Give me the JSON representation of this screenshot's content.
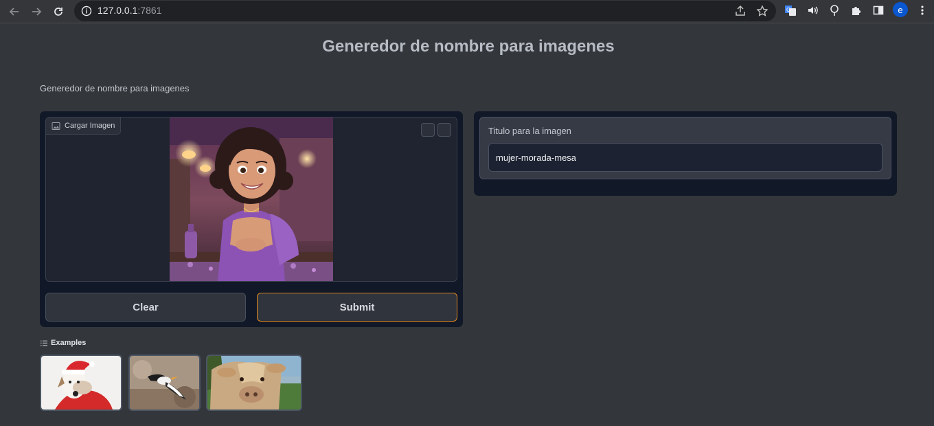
{
  "browser": {
    "url_host": "127.0.0.1",
    "url_port": ":7861",
    "profile_initial": "e",
    "icons": [
      "back-icon",
      "forward-icon",
      "reload-icon",
      "site-info-icon",
      "share-icon",
      "bookmark-star-icon",
      "translate-icon",
      "speaker-icon",
      "lens-icon",
      "extensions-icon",
      "side-panel-icon",
      "more-icon"
    ]
  },
  "app": {
    "title": "Generedor de nombre para imagenes",
    "description": "Generedor de nombre para imagenes"
  },
  "input_panel": {
    "image_label": "Cargar Imagen",
    "clear_label": "Clear",
    "submit_label": "Submit"
  },
  "output_panel": {
    "label": "Titulo para la imagen",
    "value": "mujer-morada-mesa"
  },
  "examples": {
    "title": "Examples",
    "items": [
      "dog-with-santa-hat",
      "bird-flying",
      "cow-close-up"
    ]
  },
  "colors": {
    "background": "#33363b",
    "panel": "#111827",
    "submit_border": "#e5891f"
  }
}
